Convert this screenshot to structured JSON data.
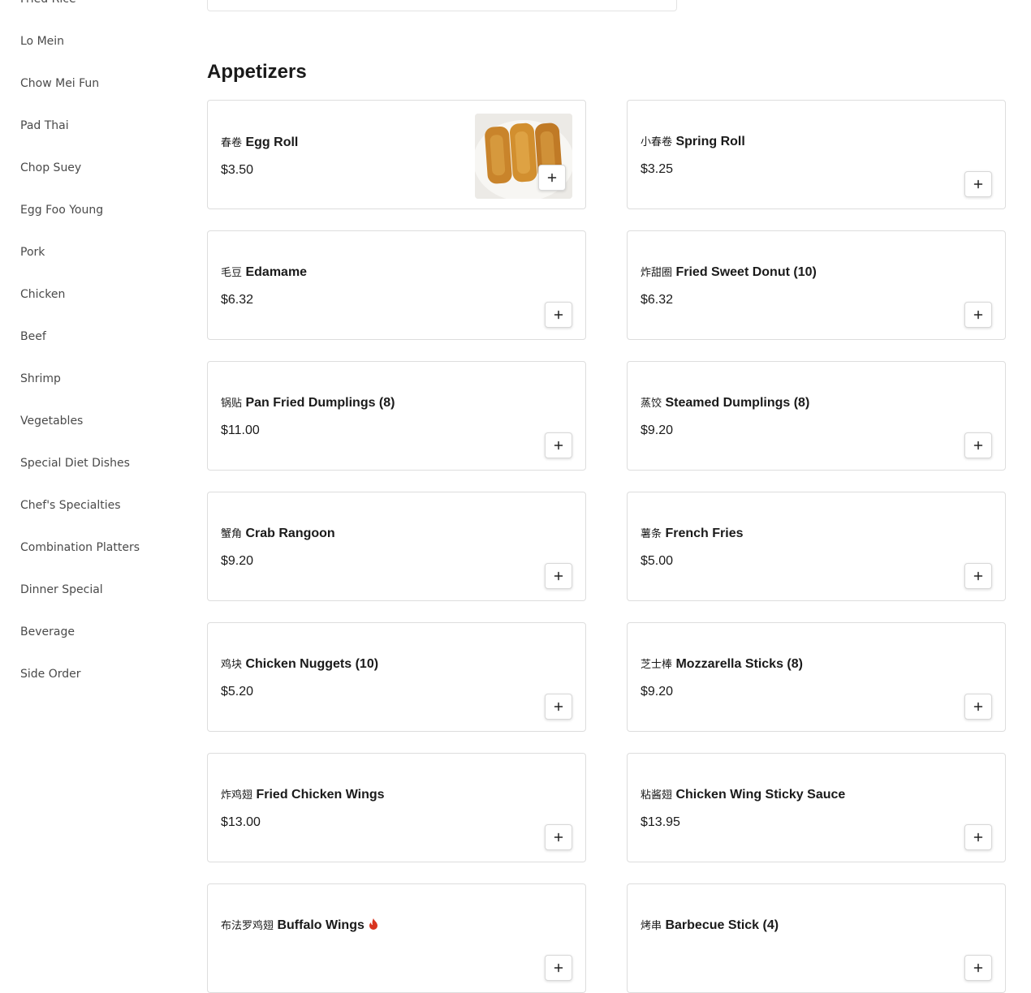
{
  "sidebar": {
    "items": [
      "Fried Rice",
      "Lo Mein",
      "Chow Mei Fun",
      "Pad Thai",
      "Chop Suey",
      "Egg Foo Young",
      "Pork",
      "Chicken",
      "Beef",
      "Shrimp",
      "Vegetables",
      "Special Diet Dishes",
      "Chef's Specialties",
      "Combination Platters",
      "Dinner Special",
      "Beverage",
      "Side Order"
    ]
  },
  "section": {
    "title": "Appetizers"
  },
  "items": [
    {
      "zh": "春卷",
      "name": "Egg Roll",
      "price": "$3.50",
      "has_image": true
    },
    {
      "zh": "小春卷",
      "name": "Spring Roll",
      "price": "$3.25"
    },
    {
      "zh": "毛豆",
      "name": "Edamame",
      "price": "$6.32"
    },
    {
      "zh": "炸甜圈",
      "name": "Fried Sweet Donut (10)",
      "price": "$6.32"
    },
    {
      "zh": "锅贴",
      "name": "Pan Fried Dumplings (8)",
      "price": "$11.00"
    },
    {
      "zh": "蒸饺",
      "name": "Steamed Dumplings (8)",
      "price": "$9.20"
    },
    {
      "zh": "蟹角",
      "name": "Crab Rangoon",
      "price": "$9.20"
    },
    {
      "zh": "薯条",
      "name": "French Fries",
      "price": "$5.00"
    },
    {
      "zh": "鸡块",
      "name": "Chicken Nuggets (10)",
      "price": "$5.20"
    },
    {
      "zh": "芝士棒",
      "name": "Mozzarella Sticks (8)",
      "price": "$9.20"
    },
    {
      "zh": "炸鸡翅",
      "name": "Fried Chicken Wings",
      "price": "$13.00"
    },
    {
      "zh": "粘酱翅",
      "name": "Chicken Wing Sticky Sauce",
      "price": "$13.95"
    },
    {
      "zh": "布法罗鸡翅",
      "name": "Buffalo Wings",
      "price": "",
      "spicy": true
    },
    {
      "zh": "烤串",
      "name": "Barbecue Stick (4)",
      "price": ""
    }
  ],
  "icons": {
    "add": "plus-icon",
    "spicy": "fire-icon"
  },
  "colors": {
    "spicy": "#d9341f",
    "border": "#dddddd"
  }
}
